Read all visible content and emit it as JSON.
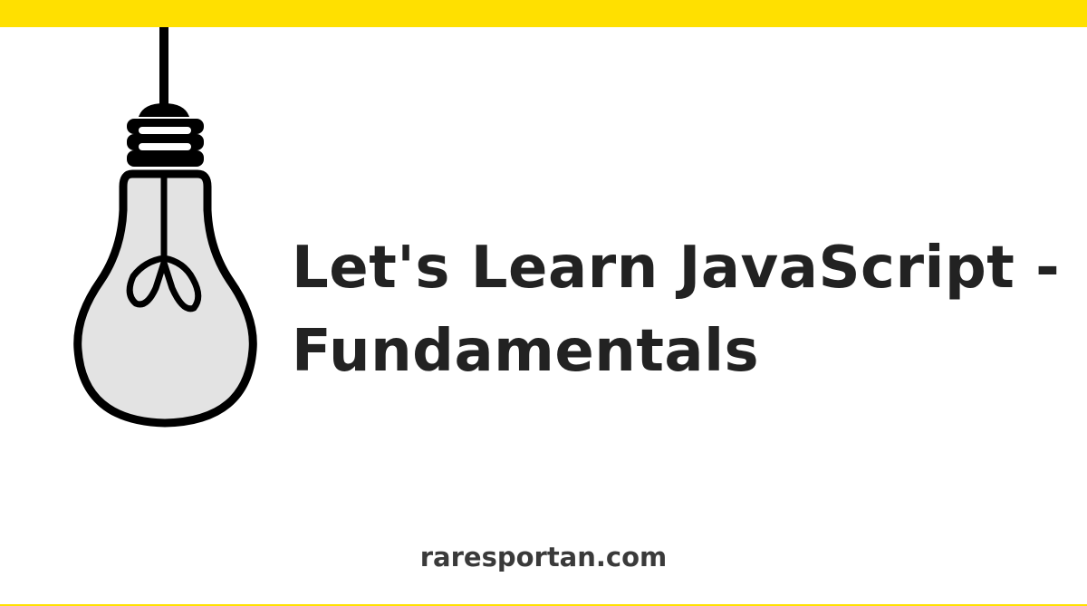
{
  "colors": {
    "accent": "#FFE000",
    "title": "#222222",
    "bulb_fill": "#E3E3E3",
    "bulb_outline": "#000000"
  },
  "illustration": {
    "icon": "lightbulb-icon"
  },
  "title": {
    "line1": "Let's Learn JavaScript -",
    "line2": "Fundamentals"
  },
  "footer": {
    "site": "raresportan.com"
  }
}
